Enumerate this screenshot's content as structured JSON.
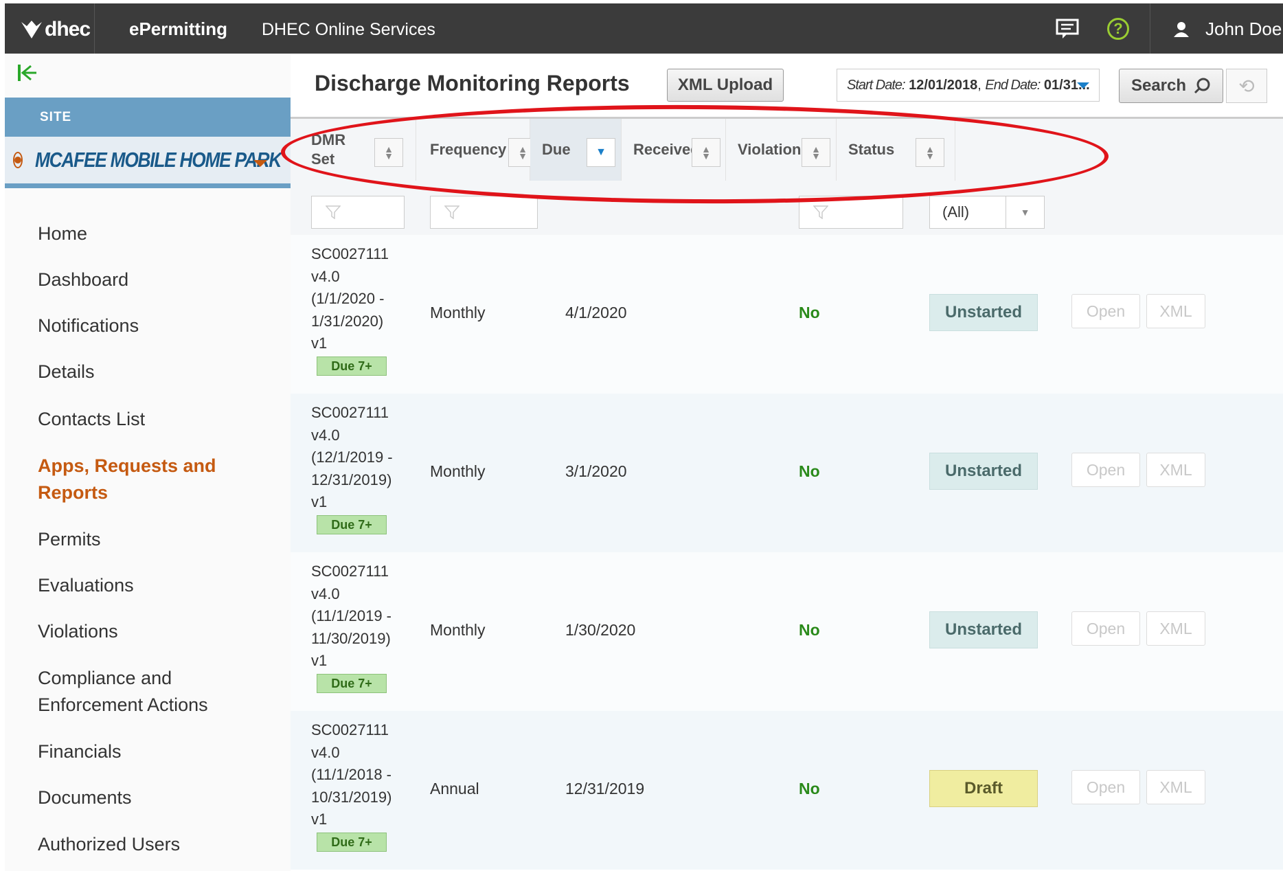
{
  "topbar": {
    "logo_text": "dhec",
    "app_name": "ePermitting",
    "service_name": "DHEC Online Services",
    "user_name": "John Doe",
    "help_glyph": "?",
    "icons": [
      "feedback-icon",
      "help-icon",
      "user-icon"
    ]
  },
  "sidebar": {
    "site_label": "SITE",
    "site_name": "MCAFEE MOBILE HOME PARK",
    "nav": [
      {
        "label": "Home"
      },
      {
        "label": "Dashboard"
      },
      {
        "label": "Notifications"
      },
      {
        "label": "Details"
      },
      {
        "label": "Contacts List"
      },
      {
        "label": "Apps, Requests and Reports",
        "line1": "Apps, Requests and",
        "line2": "Reports",
        "active": true
      },
      {
        "label": "Permits"
      },
      {
        "label": "Evaluations"
      },
      {
        "label": "Violations"
      },
      {
        "label": "Compliance and Enforcement Actions",
        "line1": "Compliance and",
        "line2": "Enforcement Actions"
      },
      {
        "label": "Financials"
      },
      {
        "label": "Documents"
      },
      {
        "label": "Authorized Users"
      }
    ]
  },
  "main": {
    "title": "Discharge Monitoring Reports",
    "xml_upload": "XML Upload",
    "date_range": {
      "start_label": "Start Date:",
      "start_value": "12/01/2018",
      "end_label": "End Date:",
      "end_value": "01/31..."
    },
    "search_label": "Search",
    "columns": {
      "dmr_set_1": "DMR",
      "dmr_set_2": "Set",
      "frequency": "Frequency",
      "due": "Due",
      "received": "Received",
      "violations": "Violations",
      "status": "Status"
    },
    "status_filter": "(All)",
    "rows": [
      {
        "dmr": [
          "SC0027111",
          "v4.0",
          "(1/1/2020 -",
          "1/31/2020)",
          "v1"
        ],
        "badge": "Due 7+",
        "frequency": "Monthly",
        "due": "4/1/2020",
        "received": "",
        "violations": "No",
        "status": "Unstarted",
        "open": "Open",
        "xml": "XML"
      },
      {
        "dmr": [
          "SC0027111",
          "v4.0",
          "(12/1/2019 -",
          "12/31/2019)",
          "v1"
        ],
        "badge": "Due 7+",
        "frequency": "Monthly",
        "due": "3/1/2020",
        "received": "",
        "violations": "No",
        "status": "Unstarted",
        "open": "Open",
        "xml": "XML"
      },
      {
        "dmr": [
          "SC0027111",
          "v4.0",
          "(11/1/2019 -",
          "11/30/2019)",
          "v1"
        ],
        "badge": "Due 7+",
        "frequency": "Monthly",
        "due": "1/30/2020",
        "received": "",
        "violations": "No",
        "status": "Unstarted",
        "open": "Open",
        "xml": "XML"
      },
      {
        "dmr": [
          "SC0027111",
          "v4.0",
          "(11/1/2018 -",
          "10/31/2019)",
          "v1"
        ],
        "badge": "Due 7+",
        "frequency": "Annual",
        "due": "12/31/2019",
        "received": "",
        "violations": "No",
        "status": "Draft",
        "open": "Open",
        "xml": "XML"
      }
    ]
  },
  "colors": {
    "topbar_bg": "#3b3b3b",
    "site_bar": "#6a9fc4",
    "active_nav": "#c55a11",
    "violation_no": "#2a8a1a",
    "annotation_oval": "#e0141a"
  }
}
